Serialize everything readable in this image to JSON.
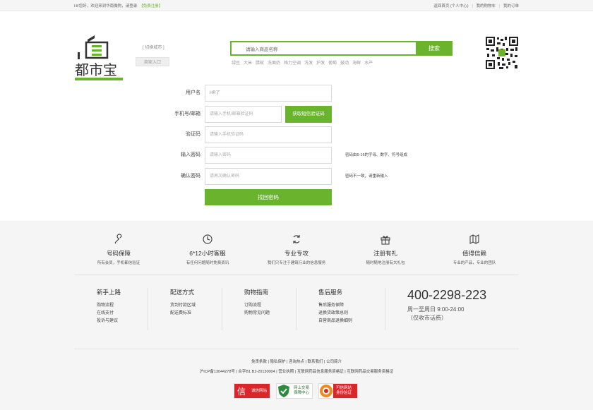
{
  "topbar": {
    "welcome": "Hi!您好，欢迎来到华南微购，请登录",
    "register": "【免费注册】",
    "links": [
      "返回首页 (个人中心)",
      "我的购物车",
      "我的订单"
    ]
  },
  "header": {
    "logo_text": "都市宝",
    "city_link": "[ 切换城市 ]",
    "merchant_entry": "商家入口",
    "search_placeholder": "请输入商品名称",
    "search_button": "搜索",
    "hot_words": [
      "绿豆",
      "大米",
      "腊蚁",
      "洗面奶",
      "格力空调",
      "洗发",
      "护发",
      "葡萄",
      "鼓动",
      "海鲜",
      "水产"
    ]
  },
  "form": {
    "username_label": "用户名",
    "username_value": "HR了",
    "phone_label": "手机号/邮箱",
    "phone_placeholder": "请输入手机/邮箱验证码",
    "getcode_button": "获取短信验证码",
    "code_label": "验证码",
    "code_placeholder": "请输入手机验证码",
    "password_label": "输入密码",
    "password_placeholder": "请输入密码",
    "password_hint": "密码由6-16的字母、数字、符号组成",
    "confirm_label": "确认密码",
    "confirm_placeholder": "请再次确认密码",
    "confirm_hint": "密码不一致，请重新输入",
    "submit": "找回密码"
  },
  "features": [
    {
      "icon": "wrench-icon",
      "title": "号码保障",
      "desc": "所有会员，手机都信验证"
    },
    {
      "icon": "clock-icon",
      "title": "6*12小时客服",
      "desc": "有任何问题随时免费资讯"
    },
    {
      "icon": "refresh-icon",
      "title": "专业专攻",
      "desc": "我们只专注于建筑行业的信息服务"
    },
    {
      "icon": "gift-icon",
      "title": "注册有礼",
      "desc": "随时随地注册有大礼包"
    },
    {
      "icon": "map-icon",
      "title": "值得信赖",
      "desc": "专业的产品，专业的团队"
    }
  ],
  "columns": [
    {
      "title": "新手上路",
      "items": [
        "购物流程",
        "在线支付",
        "投诉与建议"
      ]
    },
    {
      "title": "配送方式",
      "items": [
        "货到付款区域",
        "配送费标准"
      ]
    },
    {
      "title": "购物指南",
      "items": [
        "订购流程",
        "购物常见问题"
      ]
    },
    {
      "title": "售后服务",
      "items": [
        "售后服务保障",
        "退换货政策总则",
        "自营商品退换细则"
      ]
    }
  ],
  "hotline": {
    "number": "400-2298-223",
    "hours": "周一至周日 9:00-24:00",
    "note": "（仅收市话费）"
  },
  "footer_links": [
    "免责条款",
    "隐私保护",
    "咨询热点",
    "联系我们",
    "公司简介"
  ],
  "icp": [
    "沪ICP备13044278号",
    "合字B1.B2-20130004",
    "营业执照",
    "互联网药品信息服务资格证",
    "互联网药品交易服务资格证"
  ],
  "badges": [
    {
      "icon": "trust-icon",
      "text": "诚信网站"
    },
    {
      "icon": "shield-icon",
      "text": "网上交易保障中心"
    },
    {
      "icon": "verified-icon",
      "text": "可信网站 身份验证"
    }
  ],
  "colors": {
    "accent": "#6ab42d",
    "footer_bg": "#f5f5f5"
  }
}
